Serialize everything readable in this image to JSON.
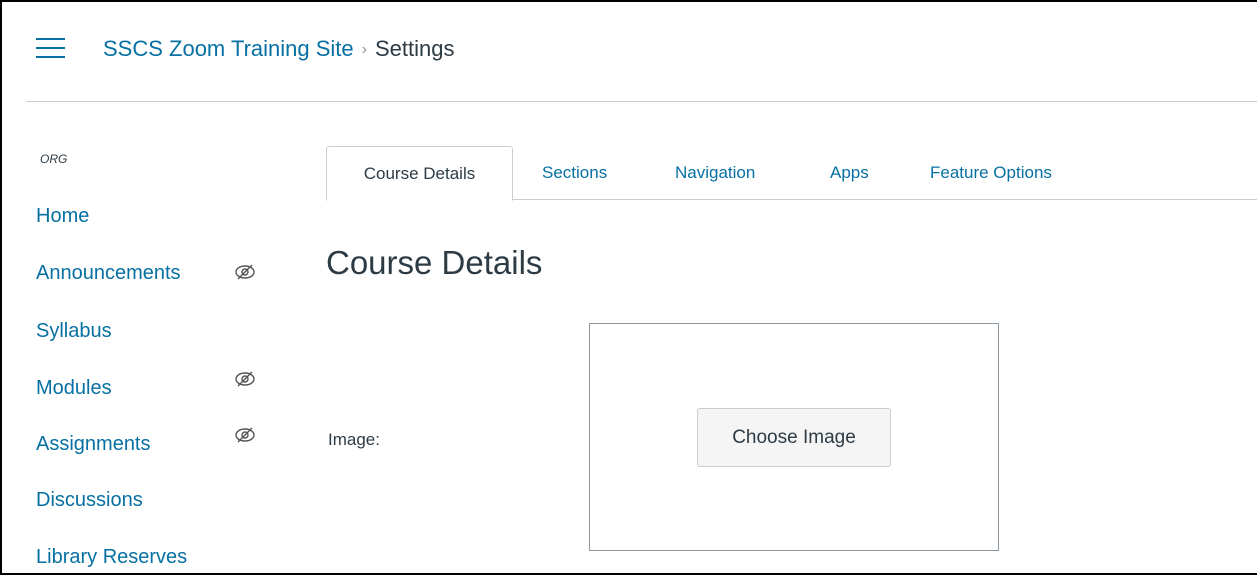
{
  "header": {
    "course_name": "SSCS Zoom Training Site",
    "separator": "›",
    "current_page": "Settings"
  },
  "sidebar": {
    "org_label": "ORG",
    "items": [
      {
        "label": "Home",
        "hidden_from_students": false
      },
      {
        "label": "Announcements",
        "hidden_from_students": true
      },
      {
        "label": "Syllabus",
        "hidden_from_students": false
      },
      {
        "label": "Modules",
        "hidden_from_students": true
      },
      {
        "label": "Assignments",
        "hidden_from_students": true
      },
      {
        "label": "Discussions",
        "hidden_from_students": false
      },
      {
        "label": "Library Reserves",
        "hidden_from_students": false
      }
    ]
  },
  "tabs": [
    {
      "label": "Course Details",
      "active": true
    },
    {
      "label": "Sections",
      "active": false
    },
    {
      "label": "Navigation",
      "active": false
    },
    {
      "label": "Apps",
      "active": false
    },
    {
      "label": "Feature Options",
      "active": false
    }
  ],
  "main": {
    "title": "Course Details",
    "image_label": "Image:",
    "choose_image_button": "Choose Image"
  },
  "colors": {
    "link": "#0770a3",
    "text": "#2d3b45",
    "border": "#c7cdd1",
    "button_bg": "#f5f5f5"
  },
  "icons": {
    "menu": "hamburger-icon",
    "hidden": "eye-slash-icon"
  }
}
